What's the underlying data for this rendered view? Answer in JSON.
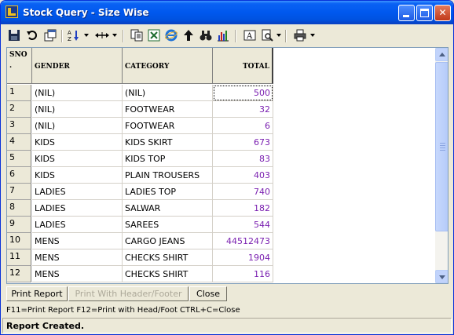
{
  "window": {
    "title": "Stock Query - Size Wise"
  },
  "toolbar": {
    "icons": [
      "save-icon",
      "undo-icon",
      "copy-window-icon",
      "sort-icon",
      "column-width-icon",
      "copy-icon",
      "excel-icon",
      "internet-explorer-icon",
      "up-arrow-icon",
      "find-icon",
      "chart-icon",
      "font-icon",
      "print-preview-icon",
      "printer-icon"
    ]
  },
  "grid": {
    "columns": {
      "sno": "SNO",
      "sno_dot": ".",
      "gender": "GENDER",
      "category": "CATEGORY",
      "total": "TOTAL"
    },
    "rows": [
      {
        "sno": "1",
        "gender": "(NIL)",
        "category": "(NIL)",
        "total": "500"
      },
      {
        "sno": "2",
        "gender": "(NIL)",
        "category": "FOOTWEAR",
        "total": "32"
      },
      {
        "sno": "3",
        "gender": "(NIL)",
        "category": "FOOTWEAR",
        "total": "6"
      },
      {
        "sno": "4",
        "gender": "KIDS",
        "category": "KIDS SKIRT",
        "total": "673"
      },
      {
        "sno": "5",
        "gender": "KIDS",
        "category": "KIDS TOP",
        "total": "83"
      },
      {
        "sno": "6",
        "gender": "KIDS",
        "category": "PLAIN TROUSERS",
        "total": "403"
      },
      {
        "sno": "7",
        "gender": "LADIES",
        "category": "LADIES TOP",
        "total": "740"
      },
      {
        "sno": "8",
        "gender": "LADIES",
        "category": "SALWAR",
        "total": "182"
      },
      {
        "sno": "9",
        "gender": "LADIES",
        "category": "SAREES",
        "total": "544"
      },
      {
        "sno": "10",
        "gender": "MENS",
        "category": "CARGO JEANS",
        "total": "44512473"
      },
      {
        "sno": "11",
        "gender": "MENS",
        "category": "CHECKS SHIRT",
        "total": "1904"
      },
      {
        "sno": "12",
        "gender": "MENS",
        "category": "CHECKS SHIRT",
        "total": "116"
      }
    ]
  },
  "buttons": {
    "print_report": "Print Report",
    "print_header_footer": "Print With Header/Footer",
    "close": "Close"
  },
  "hint": "F11=Print Report  F12=Print with Head/Foot  CTRL+C=Close",
  "status": "Report Created.",
  "colors": {
    "titlebar": "#0058ee",
    "number_text": "#7a1fb0"
  }
}
